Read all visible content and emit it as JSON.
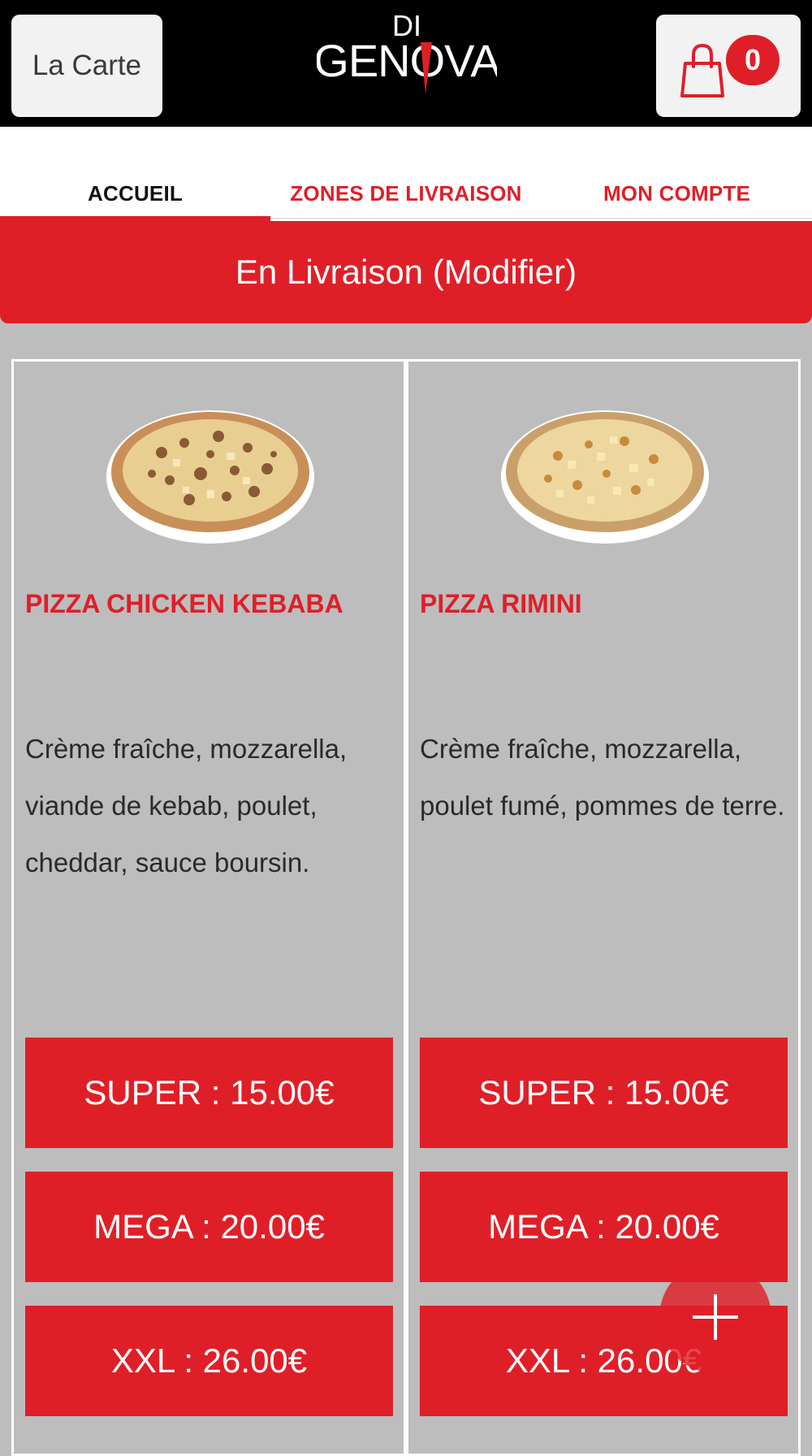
{
  "header": {
    "menu_label": "La Carte",
    "logo_top": "DI",
    "logo_main": "GENOVA",
    "cart_count": "0"
  },
  "nav": {
    "tabs": [
      {
        "label": "ACCUEIL",
        "active": true
      },
      {
        "label": "ZONES DE LIVRAISON",
        "active": false
      },
      {
        "label": "MON COMPTE",
        "active": false
      }
    ]
  },
  "delivery": {
    "label": "En Livraison (Modifier)"
  },
  "products": [
    {
      "name": "PIZZA CHICKEN KEBABA",
      "description": "Crème fraîche, mozzarella, viande de kebab, poulet, cheddar, sauce boursin.",
      "prices": [
        "SUPER : 15.00€",
        "MEGA : 20.00€",
        "XXL : 26.00€"
      ]
    },
    {
      "name": "PIZZA RIMINI",
      "description": "Crème fraîche, mozzarella, poulet fumé, pommes de terre.",
      "prices": [
        "SUPER : 15.00€",
        "MEGA : 20.00€",
        "XXL : 26.00€"
      ]
    }
  ],
  "icons": {
    "cart": "shopping-bag-icon",
    "fab": "plus-icon"
  },
  "colors": {
    "accent": "#df1f28",
    "header_bg": "#000000",
    "page_bg": "#bdbdbd"
  }
}
